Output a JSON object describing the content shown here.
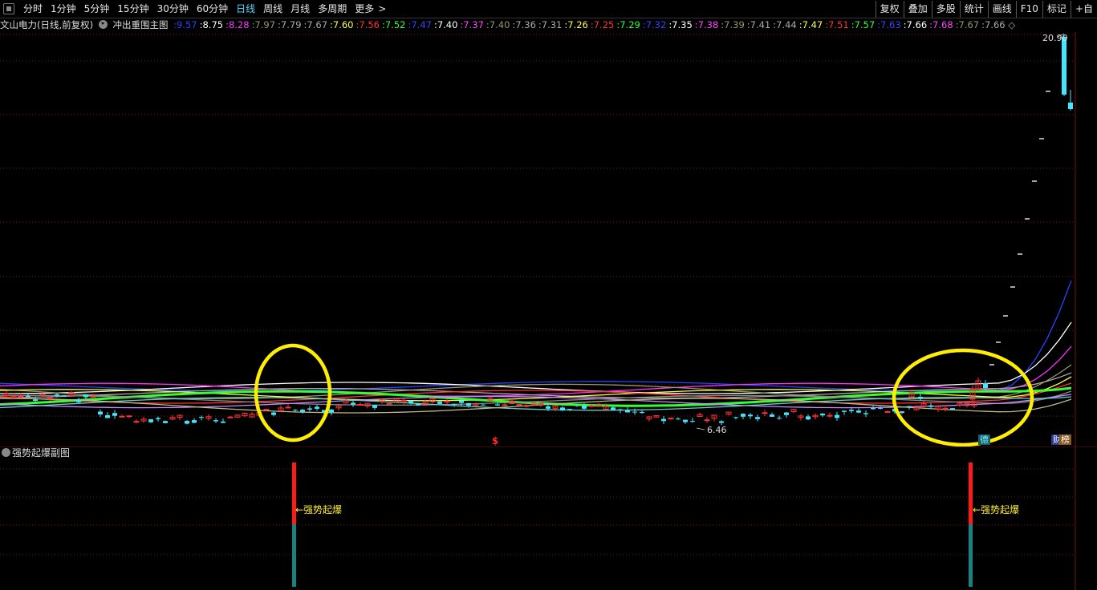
{
  "toolbar": {
    "periods": [
      "分时",
      "1分钟",
      "5分钟",
      "15分钟",
      "30分钟",
      "60分钟",
      "日线",
      "周线",
      "月线",
      "多周期",
      "更多"
    ],
    "active": "日线",
    "more_arrow": ">",
    "right_buttons": [
      "复权",
      "叠加",
      "多股",
      "统计",
      "画线",
      "F10",
      "标记",
      "+自"
    ]
  },
  "info": {
    "stock_title": "文山电力(日线,前复权)",
    "indicator": "冲出重围主图",
    "ma_values": [
      {
        "v": "9.57",
        "c": "#2244ff"
      },
      {
        "v": "8.75",
        "c": "#ffffff"
      },
      {
        "v": "8.28",
        "c": "#ff33ff"
      },
      {
        "v": "7.97",
        "c": "#999966"
      },
      {
        "v": "7.79",
        "c": "#aaaaaa"
      },
      {
        "v": "7.67",
        "c": "#aaaaaa"
      },
      {
        "v": "7.60",
        "c": "#ffff44"
      },
      {
        "v": "7.56",
        "c": "#ff3333"
      },
      {
        "v": "7.52",
        "c": "#33ff33"
      },
      {
        "v": "7.47",
        "c": "#3344ff"
      },
      {
        "v": "7.40",
        "c": "#ffffff"
      },
      {
        "v": "7.37",
        "c": "#ff44ff"
      },
      {
        "v": "7.40",
        "c": "#999966"
      },
      {
        "v": "7.36",
        "c": "#aaaaaa"
      },
      {
        "v": "7.31",
        "c": "#aaaaaa"
      },
      {
        "v": "7.26",
        "c": "#ffff44"
      },
      {
        "v": "7.25",
        "c": "#ff3333"
      },
      {
        "v": "7.29",
        "c": "#33ff33"
      },
      {
        "v": "7.32",
        "c": "#3344ff"
      },
      {
        "v": "7.35",
        "c": "#ffffff"
      },
      {
        "v": "7.38",
        "c": "#ff44ff"
      },
      {
        "v": "7.39",
        "c": "#999966"
      },
      {
        "v": "7.41",
        "c": "#aaaaaa"
      },
      {
        "v": "7.44",
        "c": "#aaaaaa"
      },
      {
        "v": "7.47",
        "c": "#ffff44"
      },
      {
        "v": "7.51",
        "c": "#ff3333"
      },
      {
        "v": "7.57",
        "c": "#33ff33"
      },
      {
        "v": "7.63",
        "c": "#3344ff"
      },
      {
        "v": "7.66",
        "c": "#ffffff"
      },
      {
        "v": "7.68",
        "c": "#ff44ff"
      },
      {
        "v": "7.67",
        "c": "#999966"
      },
      {
        "v": "7.66",
        "c": "#aaaaaa"
      }
    ],
    "end_icon": "◇"
  },
  "main_chart": {
    "high_label": "20.90",
    "low_label": "6.46",
    "dollar_mark": "$",
    "badge_de": "德",
    "badge_cai": "财",
    "badge_bang": "榜"
  },
  "sub_chart": {
    "title": "强势起爆副图",
    "signal_label": "←强势起爆"
  },
  "colors": {
    "grid": "#7a1010",
    "up": "#ff3333",
    "down": "#44e6ff",
    "highlight": "#ffee00",
    "signal_red": "#ff1a1a",
    "signal_teal": "#1a8080"
  }
}
